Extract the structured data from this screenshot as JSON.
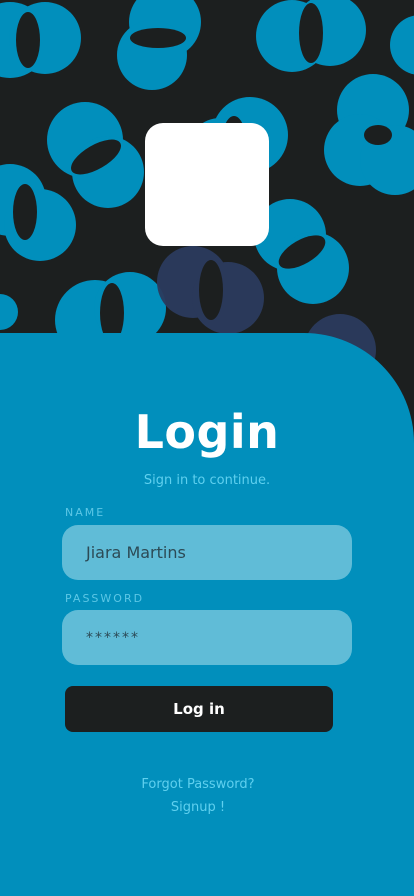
{
  "login": {
    "title": "Login",
    "subtitle": "Sign in to continue.",
    "name_label": "NAME",
    "name_value": "Jiara Martins",
    "password_label": "PASSWORD",
    "password_value": "******",
    "login_button": "Log in",
    "forgot_password": "Forgot Password?",
    "signup": "Signup !"
  },
  "colors": {
    "hero_background": "#1c1f1f",
    "accent_blue": "#018fbc",
    "field_fill": "#60bcd7",
    "button_dark": "#1c1f1f"
  }
}
